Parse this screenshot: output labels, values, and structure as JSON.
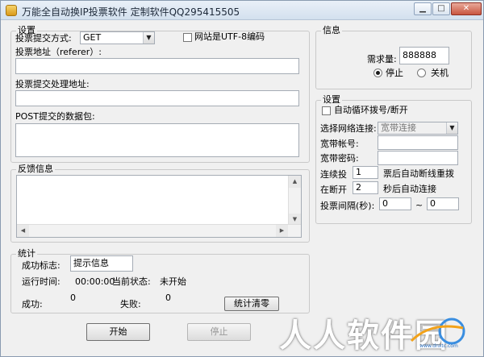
{
  "window": {
    "title": "万能全自动换IP投票软件 定制软件QQ295415505"
  },
  "vote_settings": {
    "group_label": "设置",
    "method_label": "投票提交方式:",
    "method_value": "GET",
    "utf8_label": "网站是UTF-8编码",
    "url_label": "投票地址（referer）:",
    "url_value": "",
    "handler_label": "投票提交处理地址:",
    "handler_value": "",
    "post_label": "POST提交的数据包:",
    "post_value": ""
  },
  "feedback": {
    "group_label": "反馈信息",
    "content": ""
  },
  "stats": {
    "group_label": "统计",
    "success_flag_label": "成功标志:",
    "success_flag_value": "提示信息",
    "run_time_label": "运行时间:",
    "run_time_value": "00:00:00",
    "status_label": "当前状态:",
    "status_value": "未开始",
    "success_label": "成功:",
    "success_value": "0",
    "fail_label": "失败:",
    "fail_value": "0",
    "clear_button": "统计清零"
  },
  "info": {
    "group_label": "信息",
    "required_label": "需求量:",
    "required_value": "888888",
    "radio_stop": "停止",
    "radio_shutdown": "关机",
    "selected": "stop"
  },
  "network": {
    "group_label": "设置",
    "auto_dial_label": "自动循环拨号/断开",
    "connection_label": "选择网络连接:",
    "connection_value": "宽带连接",
    "account_label": "宽带帐号:",
    "account_value": "",
    "password_label": "宽带密码:",
    "password_value": "",
    "consecutive_label": "连续投",
    "consecutive_value": "1",
    "consecutive_suffix": "票后自动断线重拨",
    "after_disconnect_label": "在断开",
    "after_disconnect_value": "2",
    "after_disconnect_suffix": "秒后自动连接",
    "interval_label": "投票间隔(秒):",
    "interval_min": "0",
    "interval_sep": "~",
    "interval_max": "0"
  },
  "actions": {
    "start_button": "开始",
    "stop_button": "停止"
  },
  "watermark": {
    "text": "人人软件园",
    "logo_text": "www.dnxtc.com"
  },
  "colors": {
    "window_bg": "#f0f0f0",
    "title_gradient_top": "#e9f0f8",
    "close_button": "#c8553f"
  },
  "icons": {
    "app": "app-icon",
    "minimize": "minimize-icon",
    "maximize": "maximize-icon",
    "close": "close-icon"
  }
}
